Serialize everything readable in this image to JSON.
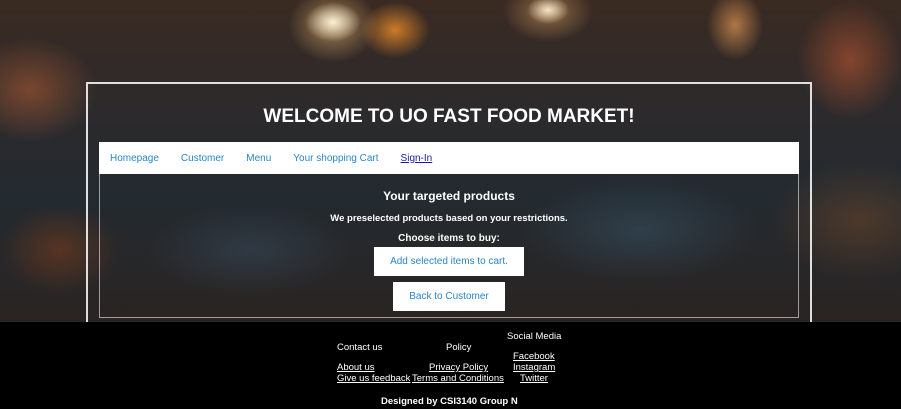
{
  "header": {
    "title": "WELCOME TO UO FAST FOOD MARKET!"
  },
  "nav": {
    "items": [
      "Homepage",
      "Customer",
      "Menu",
      "Your shopping Cart",
      "Sign-In"
    ]
  },
  "main": {
    "heading": "Your targeted products",
    "subtext": "We preselected products based on your restrictions.",
    "choose_label": "Choose items to buy:",
    "add_button": "Add selected items to cart.",
    "back_button": "Back to Customer"
  },
  "footer": {
    "contact_heading": "Contact us",
    "policy_heading": "Policy",
    "social_heading": "Social Media",
    "about_us": "About us",
    "feedback": "Give us feedback",
    "privacy": "Privacy Policy",
    "terms": "Terms and Conditions",
    "facebook": "Facebook",
    "instagram": "Instagram",
    "twitter": "Twitter",
    "credit": "Designed by CSI3140 Group N"
  },
  "colors": {
    "link": "#2a86c8",
    "signin": "#1a1aa6",
    "footer_bg": "#000000"
  }
}
